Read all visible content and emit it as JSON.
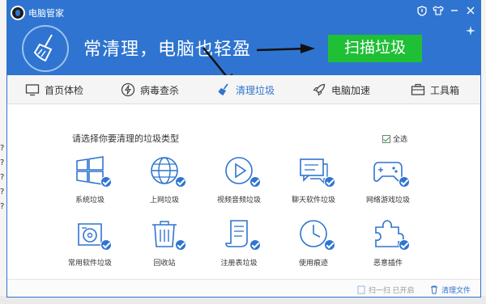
{
  "app": {
    "title": "电脑管家"
  },
  "banner": {
    "slogan": "常清理，电脑也轻盈",
    "scan_button": "扫描垃圾"
  },
  "nav": {
    "items": [
      {
        "label": "首页体检",
        "icon": "monitor-icon",
        "active": false
      },
      {
        "label": "病毒查杀",
        "icon": "lightning-icon",
        "active": false
      },
      {
        "label": "清理垃圾",
        "icon": "broom-icon",
        "active": true
      },
      {
        "label": "电脑加速",
        "icon": "rocket-icon",
        "active": false
      },
      {
        "label": "工具箱",
        "icon": "toolbox-icon",
        "active": false
      }
    ]
  },
  "panel": {
    "prompt": "请选择你要清理的垃圾类型",
    "select_all": "全选",
    "categories": [
      {
        "label": "系统垃圾",
        "icon": "windows-icon",
        "checked": true
      },
      {
        "label": "上网垃圾",
        "icon": "globe-icon",
        "checked": true
      },
      {
        "label": "视频音频垃圾",
        "icon": "play-icon",
        "checked": true
      },
      {
        "label": "聊天软件垃圾",
        "icon": "chat-icon",
        "checked": true
      },
      {
        "label": "网络游戏垃圾",
        "icon": "gamepad-icon",
        "checked": true
      },
      {
        "label": "常用软件垃圾",
        "icon": "disc-icon",
        "checked": true
      },
      {
        "label": "回收站",
        "icon": "trash-icon",
        "checked": true
      },
      {
        "label": "注册表垃圾",
        "icon": "registry-icon",
        "checked": true
      },
      {
        "label": "使用痕迹",
        "icon": "clock-icon",
        "checked": true
      },
      {
        "label": "恶意插件",
        "icon": "puzzle-icon",
        "checked": true
      }
    ]
  },
  "footer": {
    "scan_status": "扫一扫 已开启",
    "clean_files": "清理文件"
  },
  "colors": {
    "brand_blue": "#2f74d0",
    "scan_green": "#1fbf36"
  }
}
